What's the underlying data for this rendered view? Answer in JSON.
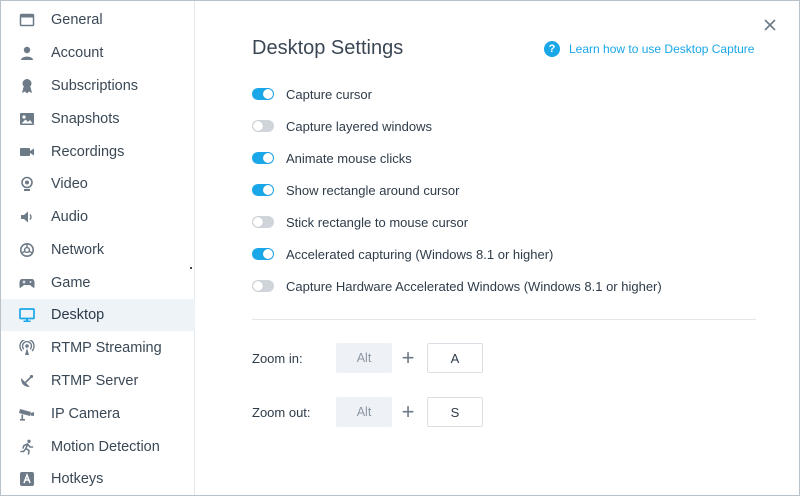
{
  "sidebar": {
    "items": [
      {
        "label": "General",
        "icon": "window-icon"
      },
      {
        "label": "Account",
        "icon": "user-icon"
      },
      {
        "label": "Subscriptions",
        "icon": "award-icon"
      },
      {
        "label": "Snapshots",
        "icon": "image-icon"
      },
      {
        "label": "Recordings",
        "icon": "video-camera-icon"
      },
      {
        "label": "Video",
        "icon": "webcam-icon"
      },
      {
        "label": "Audio",
        "icon": "speaker-icon"
      },
      {
        "label": "Network",
        "icon": "network-icon"
      },
      {
        "label": "Game",
        "icon": "gamepad-icon"
      },
      {
        "label": "Desktop",
        "icon": "monitor-icon",
        "active": true
      },
      {
        "label": "RTMP Streaming",
        "icon": "broadcast-icon"
      },
      {
        "label": "RTMP Server",
        "icon": "satellite-icon"
      },
      {
        "label": "IP Camera",
        "icon": "security-camera-icon"
      },
      {
        "label": "Motion Detection",
        "icon": "running-person-icon"
      },
      {
        "label": "Hotkeys",
        "icon": "hotkey-icon"
      }
    ]
  },
  "main": {
    "title": "Desktop Settings",
    "help_link": "Learn how to use Desktop Capture",
    "options": [
      {
        "label": "Capture cursor",
        "on": true
      },
      {
        "label": "Capture layered windows",
        "on": false
      },
      {
        "label": "Animate mouse clicks",
        "on": true
      },
      {
        "label": "Show rectangle around cursor",
        "on": true
      },
      {
        "label": "Stick rectangle to mouse cursor",
        "on": false
      },
      {
        "label": "Accelerated capturing (Windows 8.1 or higher)",
        "on": true
      },
      {
        "label": "Capture Hardware Accelerated Windows (Windows 8.1 or higher)",
        "on": false
      }
    ],
    "zoom_in": {
      "label": "Zoom in:",
      "modifier": "Alt",
      "key": "A"
    },
    "zoom_out": {
      "label": "Zoom out:",
      "modifier": "Alt",
      "key": "S"
    },
    "plus_symbol": "+"
  },
  "colors": {
    "accent": "#1aa7e8",
    "active_bg": "#eef3f8",
    "icon": "#6d7a87",
    "toggle_off": "#cfd5da"
  }
}
